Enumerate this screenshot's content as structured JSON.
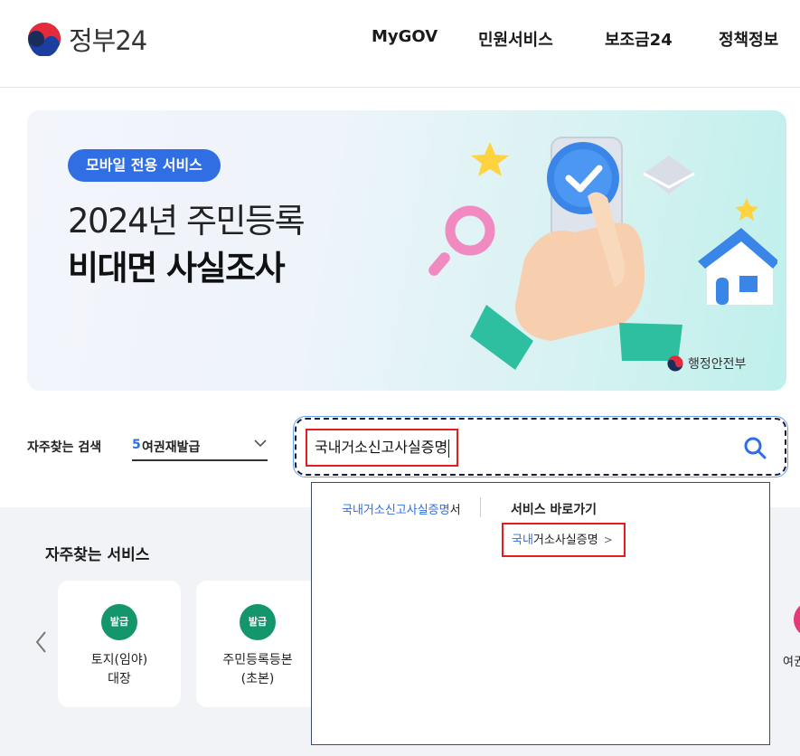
{
  "header": {
    "logo_text": "정부24",
    "nav": [
      "MyGOV",
      "민원서비스",
      "보조금24",
      "정책정보"
    ]
  },
  "banner": {
    "badge": "모바일 전용 서비스",
    "title_line1": "2024년 주민등록",
    "title_line2": "비대면 사실조사",
    "org": "행정안전부"
  },
  "search": {
    "favorites_label": "자주찾는 검색",
    "favorites_selected_num": "5",
    "favorites_selected_text": "여권재발급",
    "query": "국내거소신고사실증명"
  },
  "autocomplete": {
    "suggestion_highlight": "국내거소신고사실증명",
    "suggestion_rest": "서",
    "shortcut_title": "서비스 바로가기",
    "shortcut_highlight": "국내",
    "shortcut_rest": "거소사실증명",
    "shortcut_chevron": ">"
  },
  "services": {
    "title": "자주찾는 서비스",
    "cards": [
      {
        "badge": "발급",
        "name": "토지(임야)\n대장"
      },
      {
        "badge": "발급",
        "name": "주민등록등본\n(초본)"
      }
    ],
    "partial_card_name": "여권"
  },
  "colors": {
    "accent_blue": "#2f6fe3",
    "badge_green": "#13966b",
    "highlight_red": "#e41e1e"
  }
}
